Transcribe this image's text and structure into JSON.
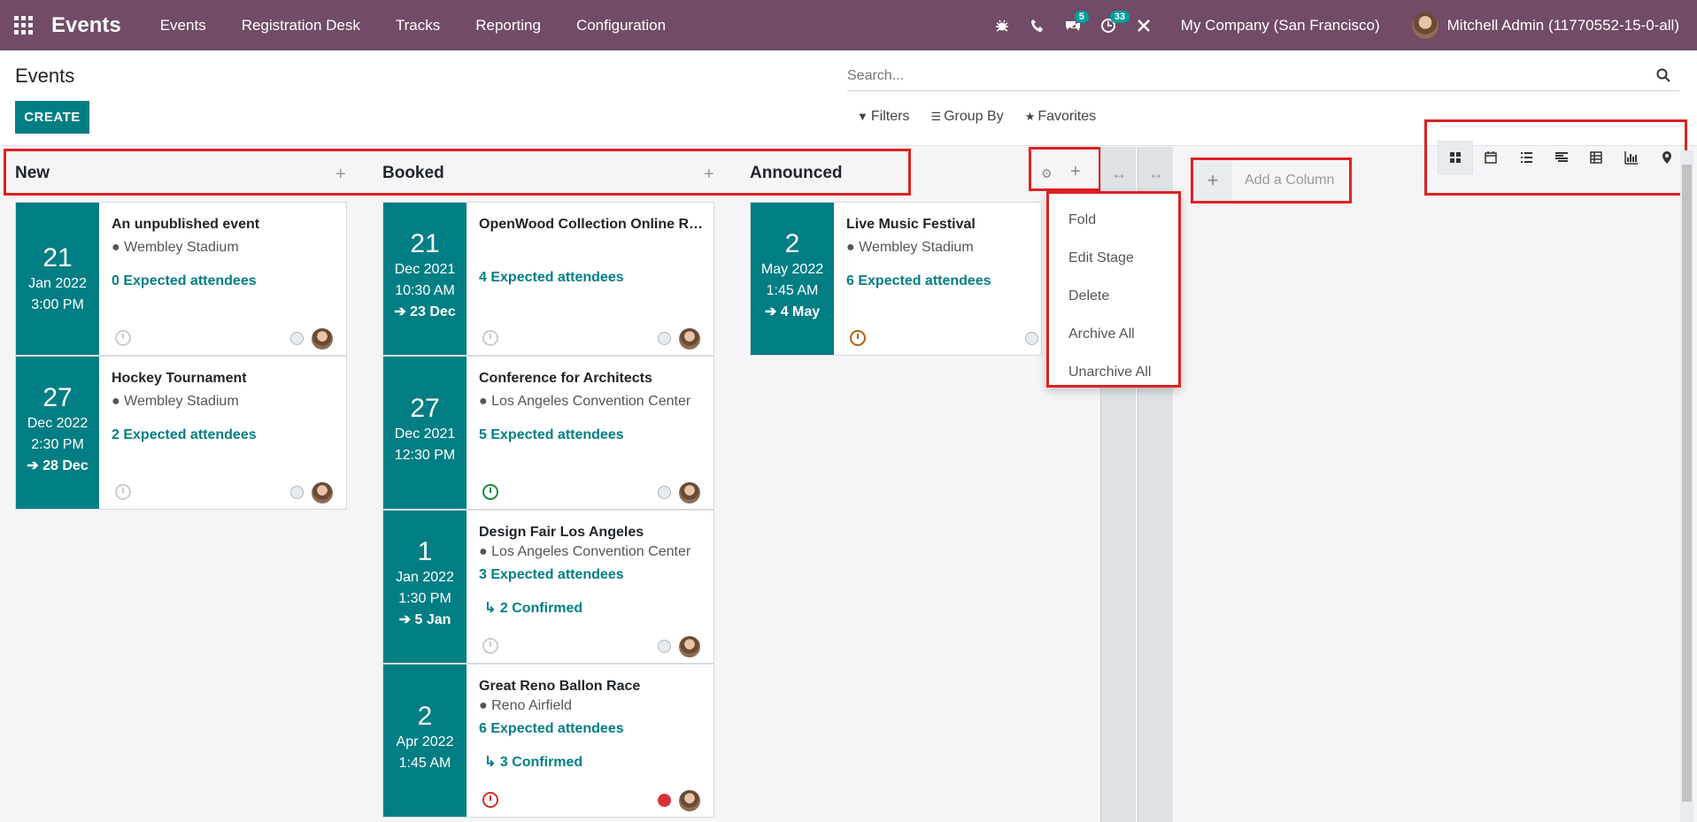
{
  "navbar": {
    "brand": "Events",
    "menu": [
      "Events",
      "Registration Desk",
      "Tracks",
      "Reporting",
      "Configuration"
    ],
    "chat_badge": "5",
    "activity_badge": "33",
    "company": "My Company (San Francisco)",
    "user": "Mitchell Admin (11770552-15-0-all)"
  },
  "control": {
    "title": "Events",
    "create_label": "CREATE",
    "search_placeholder": "Search...",
    "filters_label": "Filters",
    "groupby_label": "Group By",
    "favorites_label": "Favorites"
  },
  "columns": [
    {
      "name": "New",
      "cards": [
        {
          "day": "21",
          "month": "Jan 2022",
          "time": "3:00 PM",
          "end": "",
          "title": "An unpublished event",
          "location": "Wembley Stadium",
          "attendees": "0 Expected attendees",
          "confirmed": ""
        },
        {
          "day": "27",
          "month": "Dec 2022",
          "time": "2:30 PM",
          "end": "28 Dec",
          "title": "Hockey Tournament",
          "location": "Wembley Stadium",
          "attendees": "2 Expected attendees",
          "confirmed": ""
        }
      ]
    },
    {
      "name": "Booked",
      "cards": [
        {
          "day": "21",
          "month": "Dec 2021",
          "time": "10:30 AM",
          "end": "23 Dec",
          "title": "OpenWood Collection Online Re...",
          "location": "",
          "attendees": "4 Expected attendees",
          "confirmed": ""
        },
        {
          "day": "27",
          "month": "Dec 2021",
          "time": "12:30 PM",
          "end": "",
          "title": "Conference for Architects",
          "location": "Los Angeles Convention Center",
          "attendees": "5 Expected attendees",
          "confirmed": ""
        },
        {
          "day": "1",
          "month": "Jan 2022",
          "time": "1:30 PM",
          "end": "5 Jan",
          "title": "Design Fair Los Angeles",
          "location": "Los Angeles Convention Center",
          "attendees": "3 Expected attendees",
          "confirmed": "2 Confirmed"
        },
        {
          "day": "2",
          "month": "Apr 2022",
          "time": "1:45 AM",
          "end": "",
          "title": "Great Reno Ballon Race",
          "location": "Reno Airfield",
          "attendees": "6 Expected attendees",
          "confirmed": "3 Confirmed"
        }
      ]
    },
    {
      "name": "Announced",
      "cards": [
        {
          "day": "2",
          "month": "May 2022",
          "time": "1:45 AM",
          "end": "4 May",
          "title": "Live Music Festival",
          "location": "Wembley Stadium",
          "attendees": "6 Expected attendees",
          "confirmed": ""
        }
      ]
    }
  ],
  "dropdown": [
    "Fold",
    "Edit Stage",
    "Delete",
    "Archive All",
    "Unarchive All"
  ],
  "add_column_label": "Add a Column",
  "colors": {
    "navbar": "#714b67",
    "accent": "#017e84",
    "highlight": "#e02020"
  }
}
